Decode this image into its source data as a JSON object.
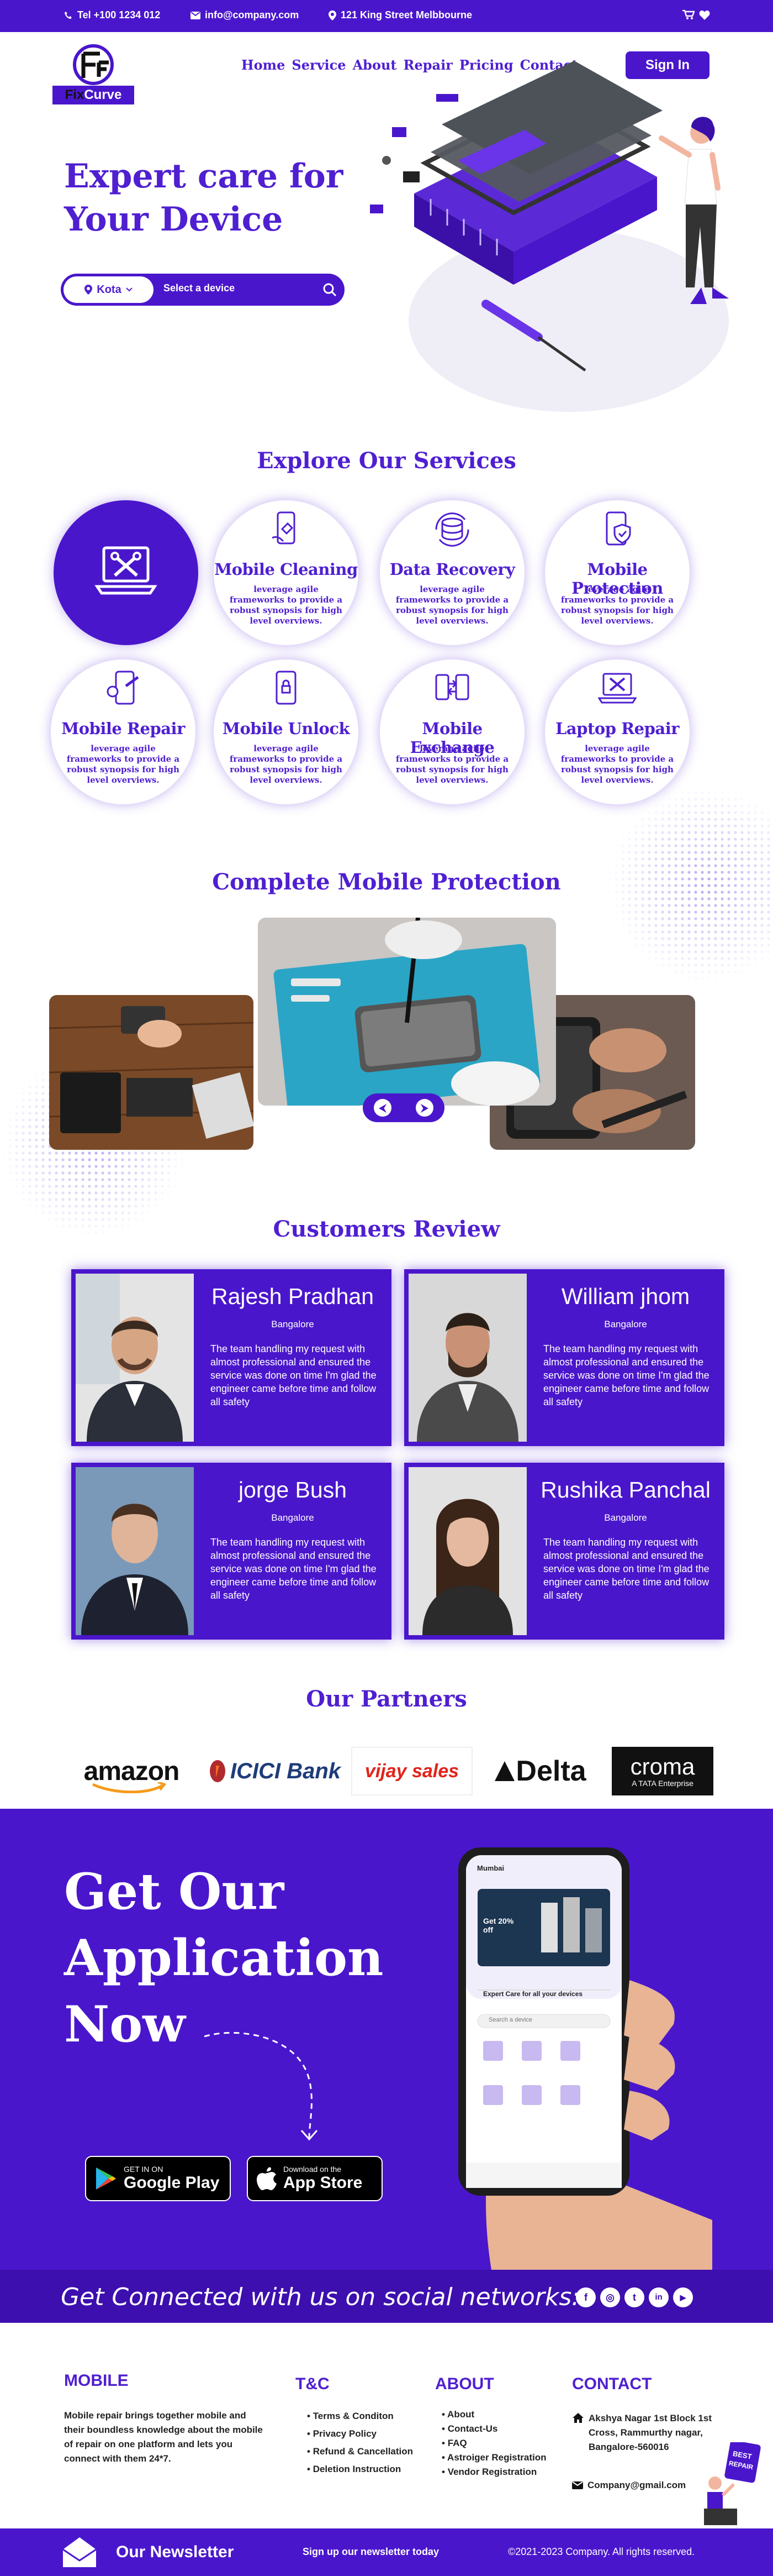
{
  "topbar": {
    "phone": "Tel +100 1234 012",
    "email": "info@company.com",
    "address": "121 King Street Melbbourne"
  },
  "header": {
    "logo_text": "Curve",
    "nav": [
      "Home",
      "Service",
      "About",
      "Repair",
      "Pricing",
      "Contact"
    ],
    "sign_in": "Sign In"
  },
  "hero": {
    "title_line1": "Expert care for",
    "title_line2": "Your Device",
    "city": "Kota",
    "device_placeholder": "Select a device"
  },
  "services": {
    "title": "Explore Our Services",
    "items": [
      {
        "name": "",
        "desc": "",
        "icon": "laptop-repair-icon"
      },
      {
        "name": "Mobile Cleaning",
        "desc": "leverage agile frameworks to provide a robust synopsis for high level overviews.",
        "icon": "phone-cleaning-icon"
      },
      {
        "name": "Data Recovery",
        "desc": "leverage agile frameworks to provide a robust synopsis for high level overviews.",
        "icon": "data-recovery-icon"
      },
      {
        "name": "Mobile Protection",
        "desc": "leverage agile frameworks to provide a robust synopsis for high level overviews.",
        "icon": "shield-phone-icon"
      },
      {
        "name": "Mobile Repair",
        "desc": "leverage agile frameworks to provide a robust synopsis for high level overviews.",
        "icon": "wrench-phone-icon"
      },
      {
        "name": "Mobile Unlock",
        "desc": "leverage agile frameworks to provide a robust synopsis for high level overviews.",
        "icon": "lock-phone-icon"
      },
      {
        "name": "Mobile Exchange",
        "desc": "leverage agile frameworks to provide a robust synopsis for high level overviews.",
        "icon": "exchange-phone-icon"
      },
      {
        "name": "Laptop Repair",
        "desc": "leverage agile frameworks to provide a robust synopsis for high level overviews.",
        "icon": "laptop-tools-icon"
      }
    ]
  },
  "protection": {
    "title": "Complete Mobile Protection",
    "prev": "⮜",
    "next": "⮞"
  },
  "reviews": {
    "title": "Customers Review",
    "items": [
      {
        "name": "Rajesh Pradhan",
        "city": "Bangalore",
        "text": "The team handling my request with almost professional and ensured the service was done on time I'm glad the engineer came before time and follow all safety"
      },
      {
        "name": "William jhom",
        "city": "Bangalore",
        "text": "The team handling my request with almost professional and ensured the service was done on time I'm glad the engineer came before time and follow all safety"
      },
      {
        "name": "jorge Bush",
        "city": "Bangalore",
        "text": "The team handling my request with almost professional and ensured the service was done on time I'm glad the engineer came before time and follow all safety"
      },
      {
        "name": "Rushika Panchal",
        "city": "Bangalore",
        "text": "The team handling my request with almost professional and ensured the service was done on time I'm glad the engineer came before time and follow all safety"
      }
    ]
  },
  "partners": {
    "title": "Our Partners",
    "items": [
      "amazon",
      "ICICI Bank",
      "vijay sales",
      "Delta",
      "croma",
      "A TATA Enterprise"
    ]
  },
  "app": {
    "title_line1": "Get Our",
    "title_line2": "Application",
    "title_line3": "Now",
    "google_small": "GET IN ON",
    "google_big": "Google Play",
    "apple_small": "Download on the",
    "apple_big": "App Store",
    "phone_location": "Mumbai",
    "phone_promo": "Get 20% off",
    "phone_heading": "Expert Care for all your devices",
    "phone_search": "Search a device"
  },
  "social": {
    "text": "Get Connected with us on social networks:",
    "icons": [
      "f",
      "◎",
      "t",
      "in",
      "▶"
    ]
  },
  "footer": {
    "col1_title": "MOBILE",
    "col1_text": "Mobile repair brings together mobile and their boundless knowledge about the mobile of repair on one platform and lets you connect with them 24*7.",
    "col2_title": "T&C",
    "col2_items": [
      "Terms & Conditon",
      "Privacy Policy",
      "Refund & Cancellation",
      "Deletion Instruction"
    ],
    "col3_title": "ABOUT",
    "col3_items": [
      "About",
      "Contact-Us",
      "FAQ",
      "Astroiger Registration",
      "Vendor Registration"
    ],
    "col4_title": "CONTACT",
    "address": "Akshya Nagar 1st Block 1st Cross, Rammurthy nagar, Bangalore-560016",
    "email": "Company@gmail.com",
    "badge": "BEST REPAIR"
  },
  "newsletter": {
    "title": "Our Newsletter",
    "signup": "Sign up our newsletter today",
    "copyright": "©2021-2023 Company. All rights reserved."
  }
}
